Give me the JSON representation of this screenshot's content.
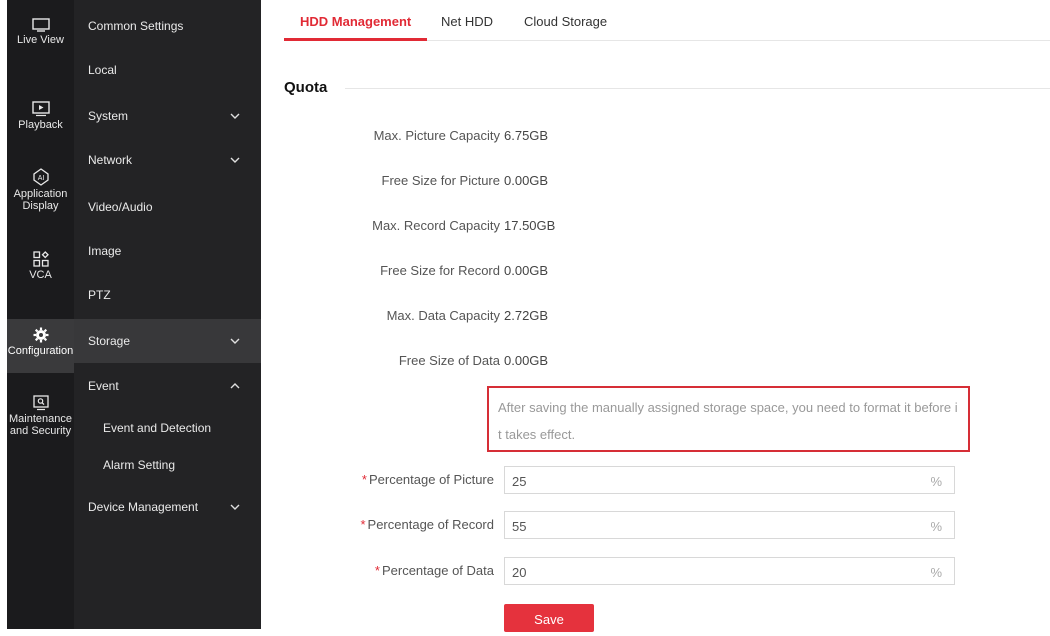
{
  "rail": {
    "items": [
      {
        "label": "Live View"
      },
      {
        "label": "Playback"
      },
      {
        "label": "Application Display",
        "line1": "Application",
        "line2": "Display"
      },
      {
        "label": "VCA"
      },
      {
        "label": "Configuration"
      },
      {
        "label": "Maintenance and Security",
        "line1": "Maintenance",
        "line2": "and Security"
      }
    ],
    "icons": [
      "monitor-icon",
      "play-icon",
      "ai-icon",
      "grid-icon",
      "gear-icon",
      "lock-monitor-icon"
    ]
  },
  "menu": {
    "common": "Common Settings",
    "local": "Local",
    "system": "System",
    "network": "Network",
    "video_audio": "Video/Audio",
    "image": "Image",
    "ptz": "PTZ",
    "storage": "Storage",
    "event": "Event",
    "event_detection": "Event and Detection",
    "alarm_setting": "Alarm Setting",
    "device_management": "Device Management"
  },
  "tabs": {
    "hdd": "HDD Management",
    "net_hdd": "Net HDD",
    "cloud": "Cloud Storage"
  },
  "quota": {
    "title": "Quota",
    "rows": [
      {
        "label": "Max. Picture Capacity",
        "value": "6.75GB"
      },
      {
        "label": "Free Size for Picture",
        "value": "0.00GB"
      },
      {
        "label": "Max. Record Capacity",
        "value": "17.50GB"
      },
      {
        "label": "Free Size for Record",
        "value": "0.00GB"
      },
      {
        "label": "Max. Data Capacity",
        "value": "2.72GB"
      },
      {
        "label": "Free Size of Data",
        "value": "0.00GB"
      }
    ],
    "notice": "After saving the manually assigned storage space, you need to format it before it takes effect.",
    "inputs": [
      {
        "required": "*",
        "label": "Percentage of Picture",
        "value": "25",
        "unit": "%"
      },
      {
        "required": "*",
        "label": "Percentage of Record",
        "value": "55",
        "unit": "%"
      },
      {
        "required": "*",
        "label": "Percentage of Data",
        "value": "20",
        "unit": "%"
      }
    ],
    "save": "Save"
  },
  "colors": {
    "accent": "#e12a35",
    "rail_bg": "#1b1b1d",
    "menu_bg": "#232325",
    "menu_active": "#38383a"
  }
}
